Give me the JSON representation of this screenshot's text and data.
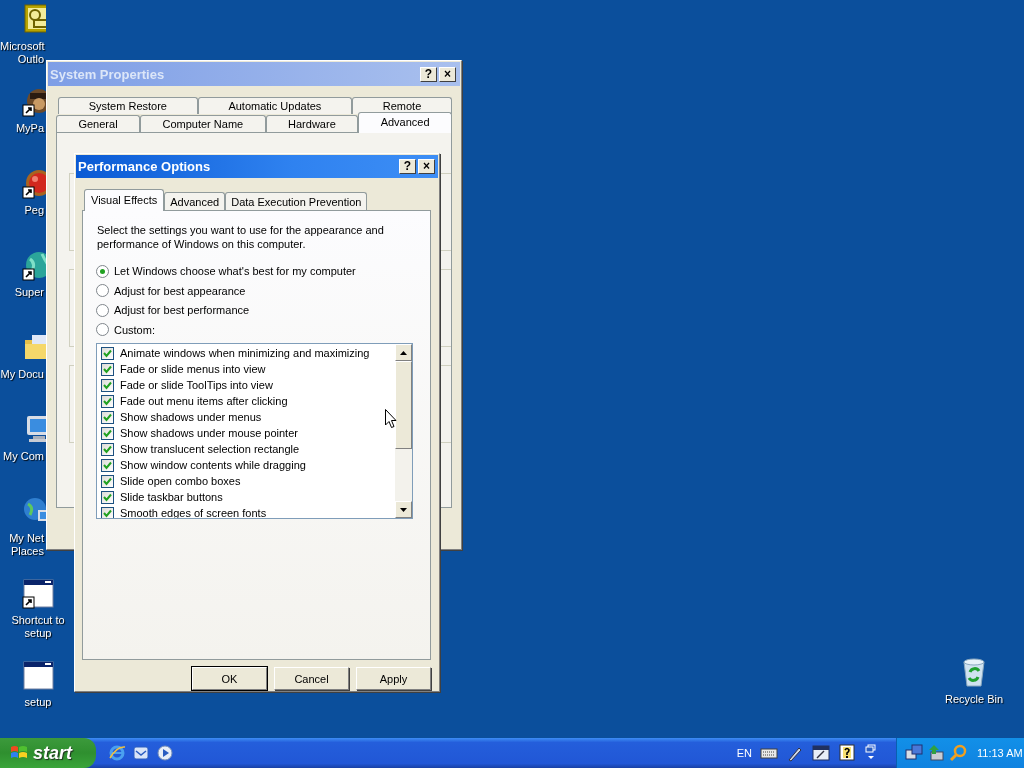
{
  "desktop_icons": [
    {
      "label": "Microsoft Outlo",
      "kind": "mail",
      "shortcut": false,
      "partly_covered": true
    },
    {
      "label": "MyPa",
      "kind": "app",
      "shortcut": true,
      "partly_covered": true
    },
    {
      "label": "Peg",
      "kind": "ball",
      "shortcut": true,
      "partly_covered": true
    },
    {
      "label": "Super",
      "kind": "globe",
      "shortcut": true,
      "partly_covered": true
    },
    {
      "label": "My Docu",
      "kind": "folder",
      "shortcut": false,
      "partly_covered": true
    },
    {
      "label": "My Com",
      "kind": "computer",
      "shortcut": false,
      "partly_covered": true
    },
    {
      "label": "My Net Places",
      "kind": "network",
      "shortcut": false,
      "partly_covered": true
    },
    {
      "label": "Shortcut to setup",
      "kind": "window",
      "shortcut": true,
      "partly_covered": false
    },
    {
      "label": "setup",
      "kind": "window",
      "shortcut": false,
      "partly_covered": false
    }
  ],
  "recycle_bin": {
    "label": "Recycle Bin"
  },
  "system_properties": {
    "title": "System Properties",
    "help_button": "?",
    "close_button": "×",
    "tab_rows": [
      [
        {
          "label": "System Restore",
          "selected": false
        },
        {
          "label": "Automatic Updates",
          "selected": false
        },
        {
          "label": "Remote",
          "selected": false
        }
      ],
      [
        {
          "label": "General",
          "selected": false
        },
        {
          "label": "Computer Name",
          "selected": false
        },
        {
          "label": "Hardware",
          "selected": false
        },
        {
          "label": "Advanced",
          "selected": true
        }
      ]
    ]
  },
  "performance_options": {
    "title": "Performance Options",
    "help_button": "?",
    "close_button": "×",
    "tabs": [
      {
        "label": "Visual Effects",
        "selected": true
      },
      {
        "label": "Advanced",
        "selected": false
      },
      {
        "label": "Data Execution Prevention",
        "selected": false
      }
    ],
    "description": "Select the settings you want to use for the appearance and performance of Windows on this computer.",
    "radios": [
      {
        "label": "Let Windows choose what's best for my computer",
        "selected": true
      },
      {
        "label": "Adjust for best appearance",
        "selected": false
      },
      {
        "label": "Adjust for best performance",
        "selected": false
      },
      {
        "label": "Custom:",
        "selected": false
      }
    ],
    "effects": [
      {
        "label": "Animate windows when minimizing and maximizing",
        "checked": true
      },
      {
        "label": "Fade or slide menus into view",
        "checked": true
      },
      {
        "label": "Fade or slide ToolTips into view",
        "checked": true
      },
      {
        "label": "Fade out menu items after clicking",
        "checked": true
      },
      {
        "label": "Show shadows under menus",
        "checked": true
      },
      {
        "label": "Show shadows under mouse pointer",
        "checked": true
      },
      {
        "label": "Show translucent selection rectangle",
        "checked": true
      },
      {
        "label": "Show window contents while dragging",
        "checked": true
      },
      {
        "label": "Slide open combo boxes",
        "checked": true
      },
      {
        "label": "Slide taskbar buttons",
        "checked": true
      },
      {
        "label": "Smooth edges of screen fonts",
        "checked": true
      }
    ],
    "buttons": [
      {
        "label": "OK",
        "default": true
      },
      {
        "label": "Cancel",
        "default": false
      },
      {
        "label": "Apply",
        "default": false
      }
    ]
  },
  "taskbar": {
    "start_label": "start",
    "quick_launch": [
      {
        "kind": "browser"
      },
      {
        "kind": "mail"
      },
      {
        "kind": "media"
      }
    ],
    "language": "EN",
    "language_bar": [
      {
        "kind": "keyboard"
      },
      {
        "kind": "pen"
      },
      {
        "kind": "screen"
      },
      {
        "kind": "help"
      },
      {
        "kind": "restore"
      }
    ],
    "tray": [
      {
        "kind": "network"
      },
      {
        "kind": "transfer"
      },
      {
        "kind": "search"
      }
    ],
    "clock": "11:13 AM"
  }
}
